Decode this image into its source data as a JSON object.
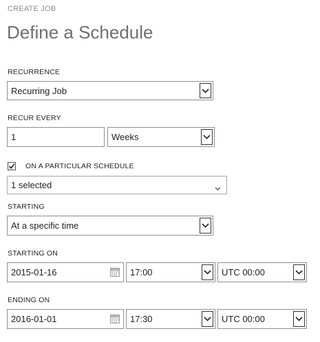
{
  "header": {
    "breadcrumb": "CREATE JOB",
    "title": "Define a Schedule"
  },
  "recurrence": {
    "label": "RECURRENCE",
    "value": "Recurring Job"
  },
  "recur_every": {
    "label": "RECUR EVERY",
    "count": "1",
    "unit": "Weeks"
  },
  "particular_schedule": {
    "label": "ON A PARTICULAR SCHEDULE",
    "checked": true,
    "selection": "1 selected"
  },
  "starting": {
    "label": "STARTING",
    "value": "At a specific time"
  },
  "starting_on": {
    "label": "STARTING ON",
    "date": "2015-01-16",
    "time": "17:00",
    "timezone": "UTC 00:00"
  },
  "ending_on": {
    "label": "ENDING ON",
    "date": "2016-01-01",
    "time": "17:30",
    "timezone": "UTC 00:00"
  },
  "icons": {
    "select_arrow": "chevron-down-icon",
    "calendar": "calendar-icon",
    "checkbox": "checkmark-icon"
  }
}
